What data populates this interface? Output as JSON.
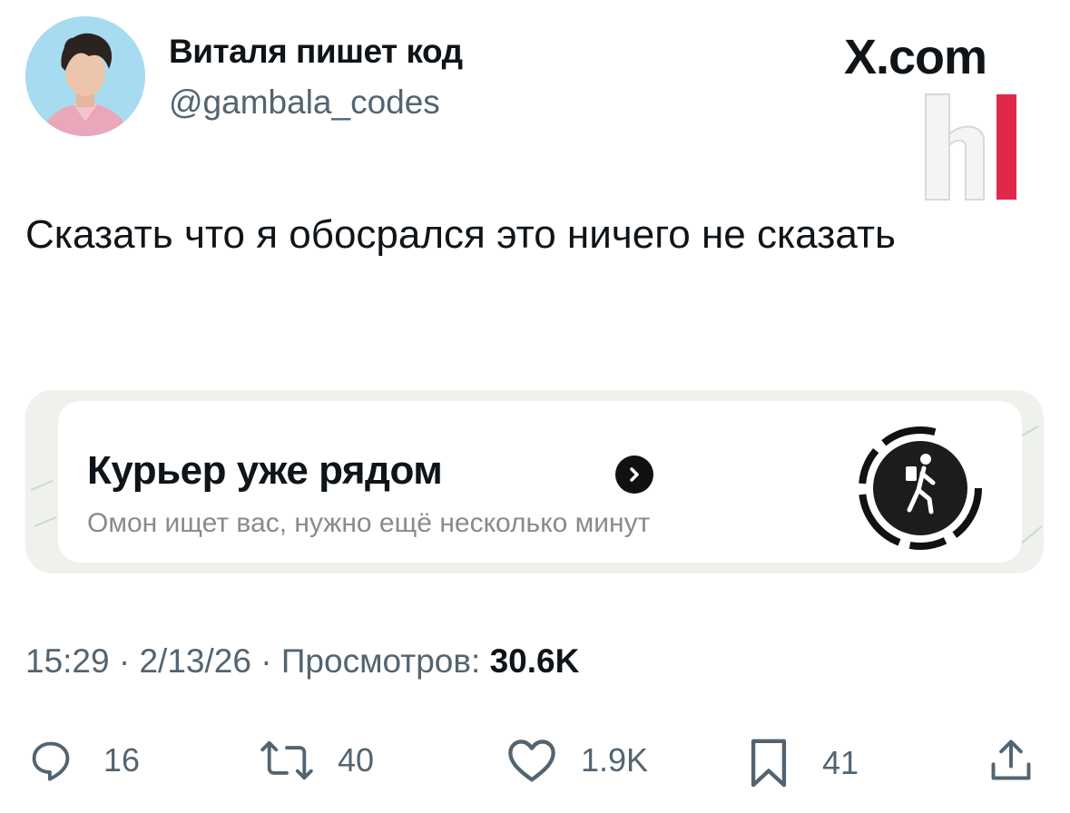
{
  "author": {
    "display_name": "Виталя пишет код",
    "handle": "@gambala_codes"
  },
  "watermark": {
    "site": "X.com",
    "logo_icon": "h-logo-icon"
  },
  "tweet": {
    "text": "Сказать что я обосрался это ничего не сказать"
  },
  "card": {
    "title": "Курьер уже рядом",
    "subtitle": "Омон ищет вас, нужно ещё несколько минут",
    "arrow_icon": "chevron-right-circle-icon",
    "courier_icon": "walking-courier-icon"
  },
  "meta": {
    "time": "15:29",
    "date": "2/13/26",
    "views_label": "Просмотров:",
    "views_count": "30.6K"
  },
  "actions": {
    "replies": "16",
    "retweets": "40",
    "likes": "1.9K",
    "bookmarks": "41"
  },
  "colors": {
    "text": "#0f1419",
    "secondary": "#536471",
    "logo_red": "#e0294a"
  }
}
